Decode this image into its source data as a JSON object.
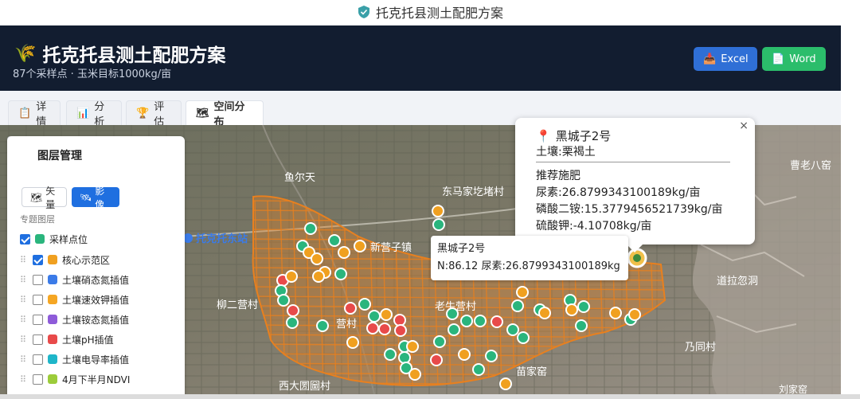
{
  "window": {
    "title": "托克托县测土配肥方案"
  },
  "header": {
    "title": "托克托县测土配肥方案",
    "subtitle": "87个采样点 · 玉米目标1000kg/亩",
    "excel_label": "Excel",
    "word_label": "Word"
  },
  "tabs": [
    {
      "label": "详情",
      "icon": "clipboard-icon"
    },
    {
      "label": "分析",
      "icon": "bar-chart-icon"
    },
    {
      "label": "评估",
      "icon": "trophy-icon"
    },
    {
      "label": "空间分布",
      "icon": "map-icon",
      "active": true
    }
  ],
  "panel": {
    "title": "图层管理",
    "basemap_vector": "矢量",
    "basemap_image": "影像",
    "section_label": "专题图层",
    "layers": [
      {
        "label": "采样点位",
        "color": "#2ab57d",
        "checked": true
      },
      {
        "label": "核心示范区",
        "color": "#f0a020",
        "checked": true
      },
      {
        "label": "土壤硝态氮插值",
        "color": "#3b7be8",
        "checked": false
      },
      {
        "label": "土壤速效钾插值",
        "color": "#f5a623",
        "checked": false
      },
      {
        "label": "土壤铵态氮插值",
        "color": "#8e5bd9",
        "checked": false
      },
      {
        "label": "土壤pH插值",
        "color": "#e84a4a",
        "checked": false
      },
      {
        "label": "土壤电导率插值",
        "color": "#1fb6c9",
        "checked": false
      },
      {
        "label": "4月下半月NDVI",
        "color": "#9ccc3a",
        "checked": false
      }
    ]
  },
  "map_labels": {
    "l1": "鱼尔天",
    "l2": "东马家圪堵村",
    "l3": "托克托东站",
    "l4": "新营子镇",
    "l5": "柳二营村",
    "l6": "老牛营村",
    "l7": "道拉忽洞",
    "l8": "曹老八窑",
    "l9": "乃同村",
    "l10": "营村",
    "l11": "苗家窑",
    "l12": "西大圐圙村",
    "l13": "刘家窑"
  },
  "popup": {
    "name": "黑城子2号",
    "soil": "土壤:栗褐土",
    "heading": "推荐施肥",
    "urea": "尿素:26.8799343100189kg/亩",
    "dap": "磷酸二铵:15.3779456521739kg/亩",
    "potash": "硫酸钾:-4.10708kg/亩",
    "close": "×"
  },
  "tooltip": {
    "name": "黑城子2号",
    "detail": "N:86.12 尿素:26.8799343100189kg"
  },
  "colors": {
    "header_bg": "#121d30",
    "accent_blue": "#1f6fe0",
    "green": "#2bbd6b",
    "point_green": "#2ab57d",
    "point_orange": "#f0a020",
    "point_red": "#e84a4a",
    "demo_area": "#e8801f"
  }
}
